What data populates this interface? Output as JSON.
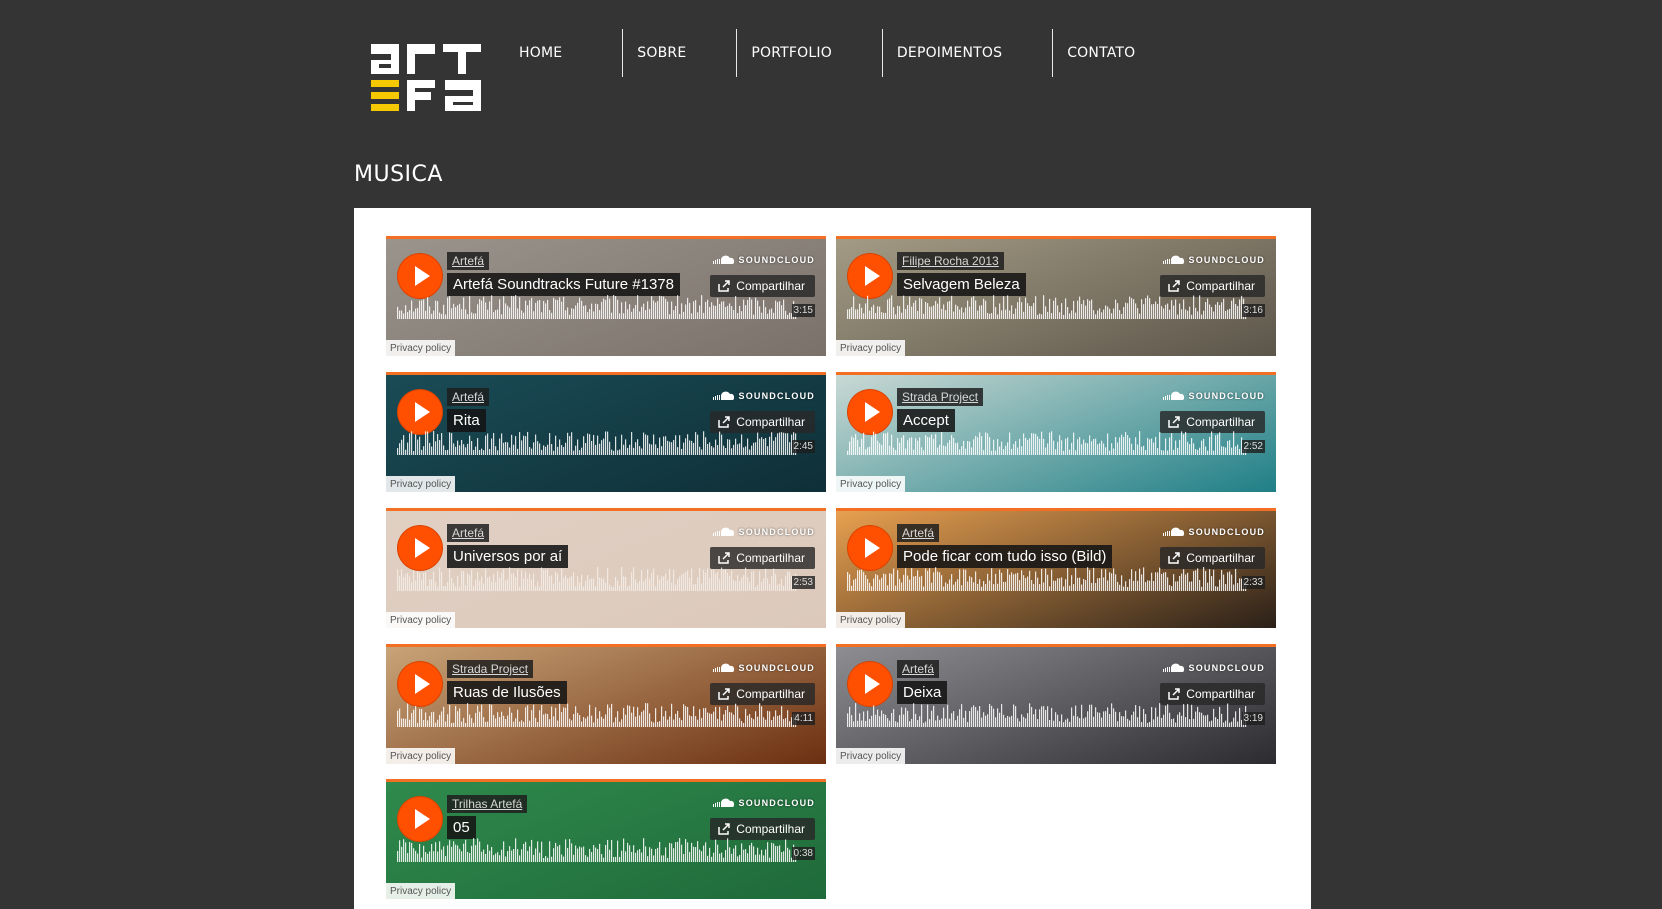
{
  "nav": {
    "items": [
      {
        "label": "HOME"
      },
      {
        "label": "SOBRE"
      },
      {
        "label": "PORTFOLIO"
      },
      {
        "label": "DEPOIMENTOS"
      },
      {
        "label": "CONTATO"
      }
    ]
  },
  "logo": {
    "text_top": "art",
    "text_bottom": "efa"
  },
  "page": {
    "title": "MUSICA"
  },
  "common": {
    "soundcloud_label": "SOUNDCLOUD",
    "share_label": "Compartilhar",
    "privacy_label": "Privacy policy"
  },
  "players": [
    {
      "artist": "Artefá",
      "track": "Artefá Soundtracks Future #1378",
      "duration": "3:15",
      "bg": [
        "#9a948c",
        "#7a716a"
      ],
      "wave": "#ffffff"
    },
    {
      "artist": "Filipe Rocha 2013",
      "track": "Selvagem Beleza",
      "duration": "3:16",
      "bg": [
        "#a39b84",
        "#5c554a"
      ],
      "wave": "#ffffff"
    },
    {
      "artist": "Artefá",
      "track": "Rita",
      "duration": "2:45",
      "bg": [
        "#1a4c56",
        "#0f2f37"
      ],
      "wave": "#ffffff"
    },
    {
      "artist": "Strada Project",
      "track": "Accept",
      "duration": "2:52",
      "bg": [
        "#c9d9d4",
        "#1f7f86"
      ],
      "wave": "#ffffff"
    },
    {
      "artist": "Artefá",
      "track": "Universos por aí",
      "duration": "2:53",
      "bg": [
        "#e0d0c3",
        "#dcc9bb"
      ],
      "wave": "#f4ede8"
    },
    {
      "artist": "Artefá",
      "track": "Pode ficar com tudo isso (Bild)",
      "duration": "2:33",
      "bg": [
        "#e8a050",
        "#2a2018"
      ],
      "wave": "#ffffff"
    },
    {
      "artist": "Strada Project",
      "track": "Ruas de Ilusões",
      "duration": "4:11",
      "bg": [
        "#c9a478",
        "#6b2f10"
      ],
      "wave": "#ffffff"
    },
    {
      "artist": "Artefá",
      "track": "Deixa",
      "duration": "3:19",
      "bg": [
        "#8e8e92",
        "#2c2c30"
      ],
      "wave": "#ffffff"
    },
    {
      "artist": "Trilhas Artefá",
      "track": "05",
      "duration": "0:38",
      "bg": [
        "#2f8a4c",
        "#1f6a3a"
      ],
      "wave": "#ffffff"
    }
  ]
}
